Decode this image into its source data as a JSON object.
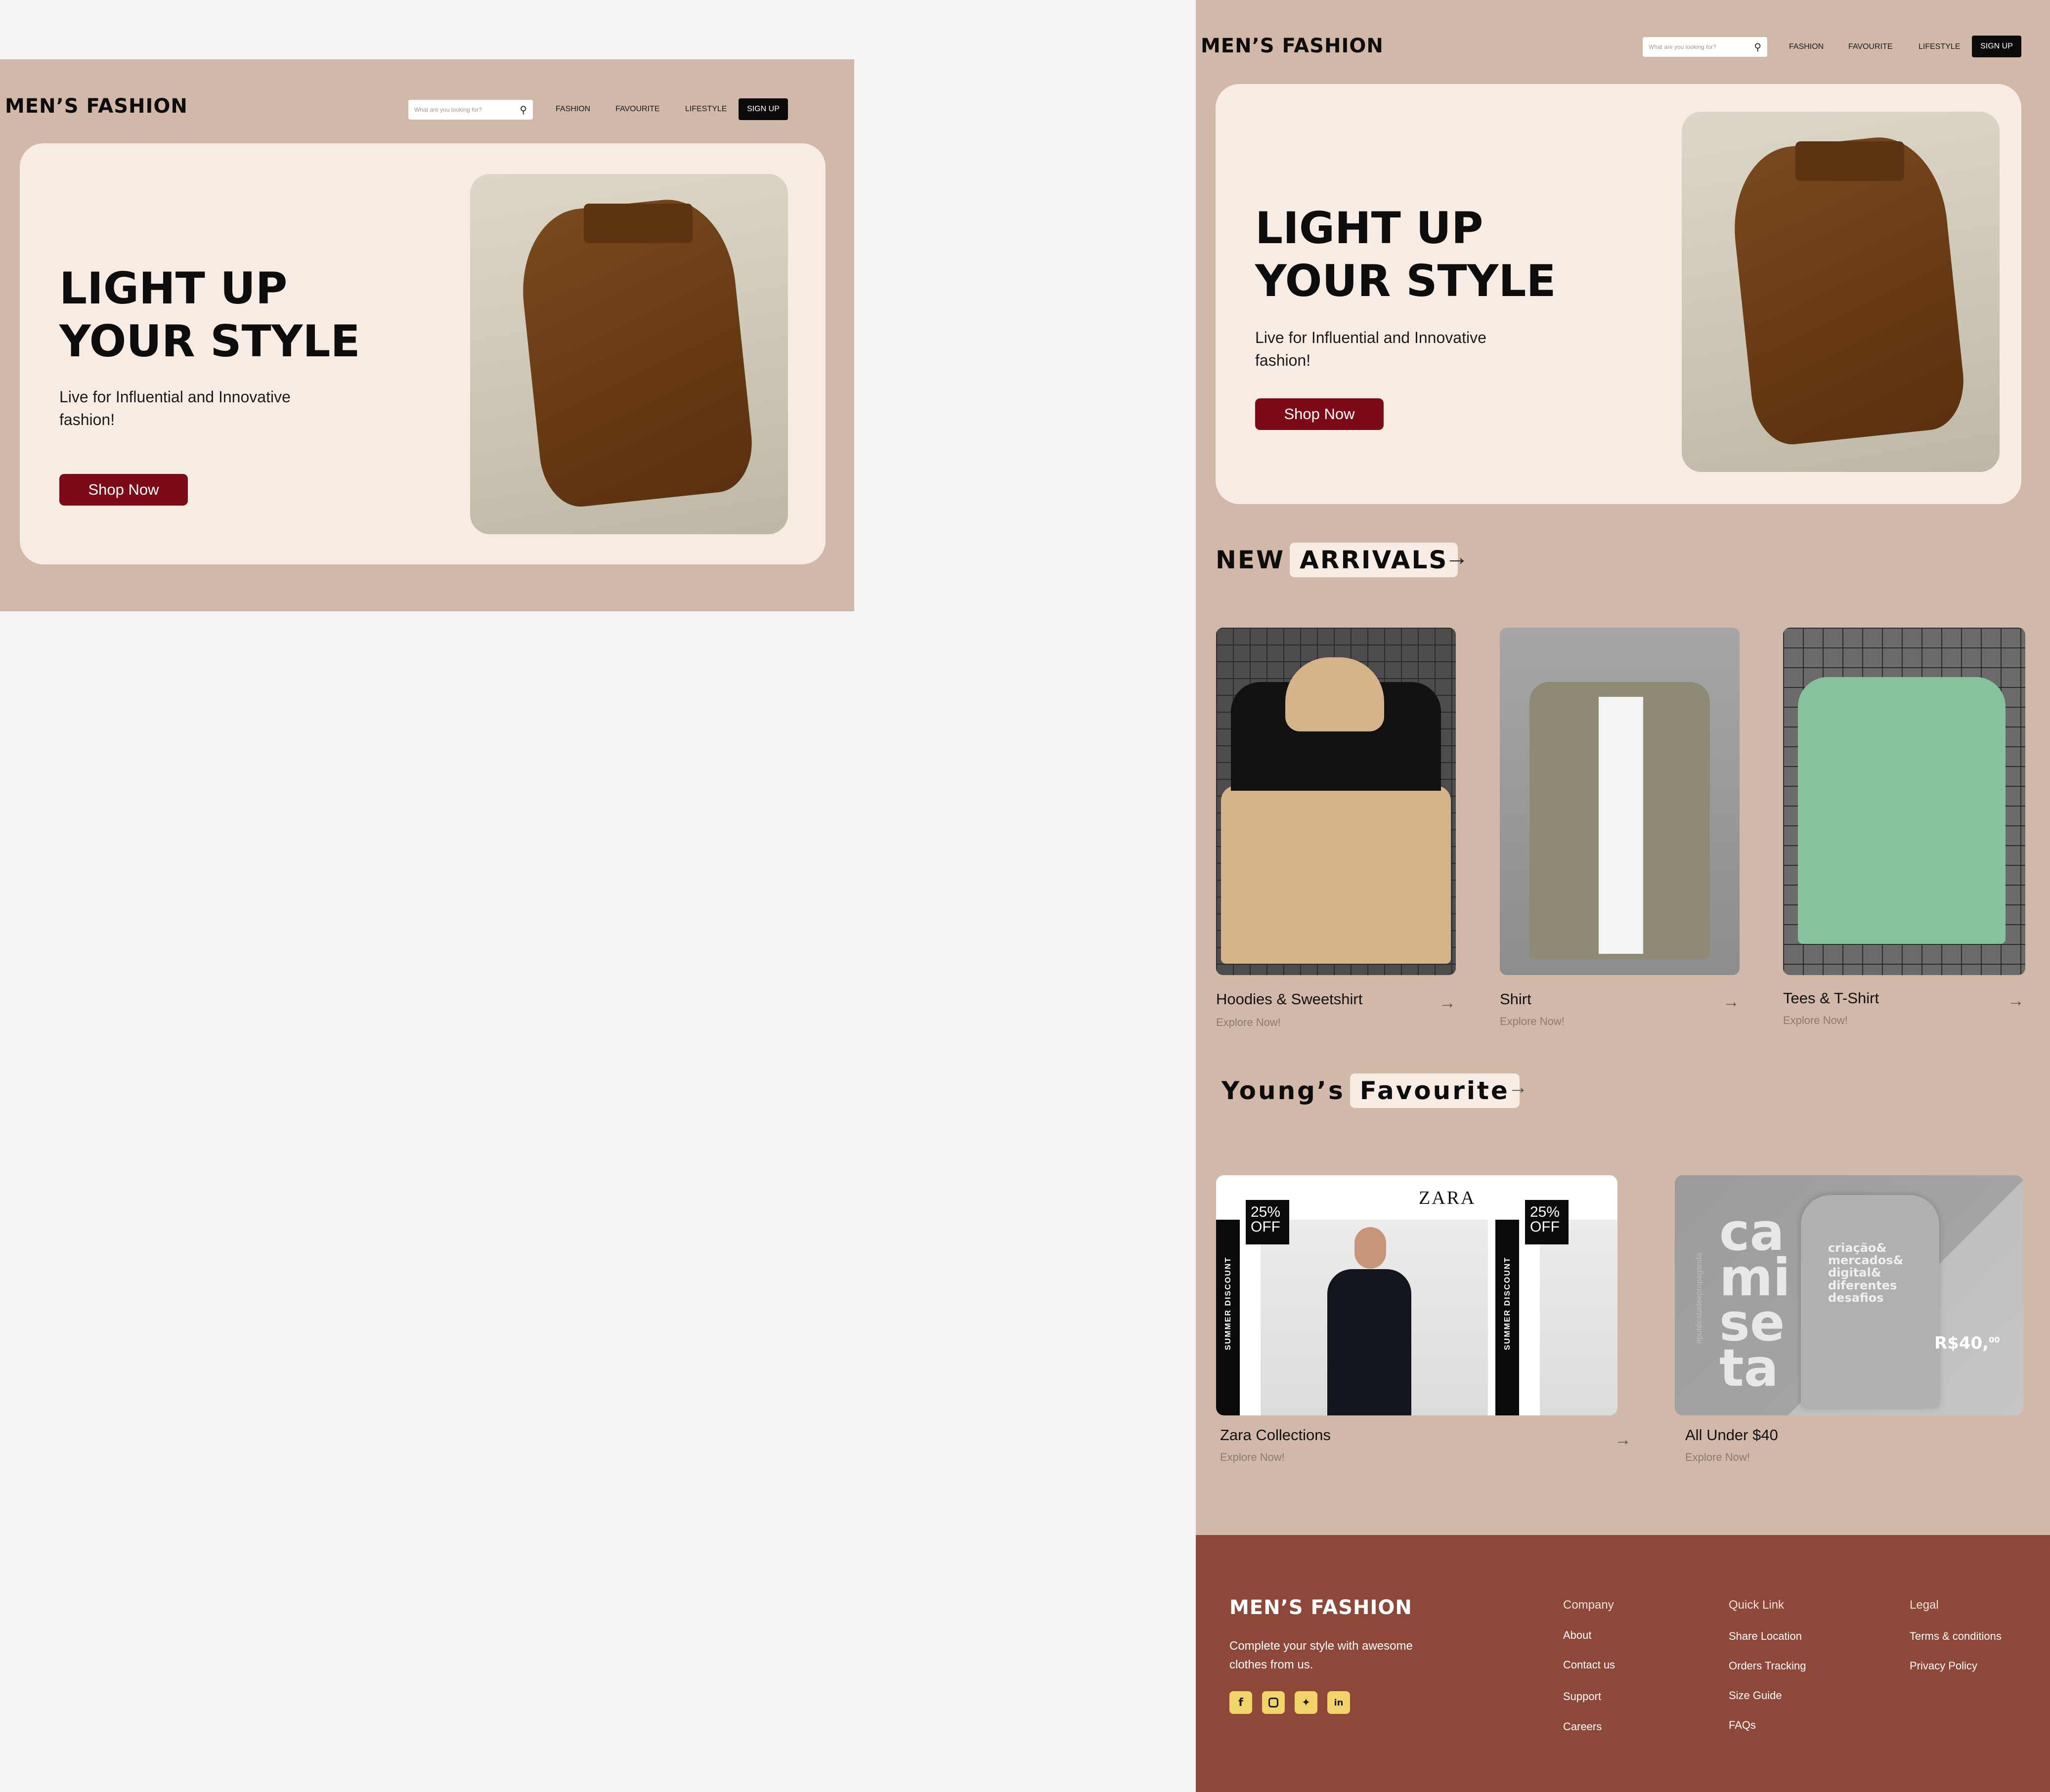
{
  "brand": "MEN’S FASHION",
  "search": {
    "placeholder": "What are you looking for?"
  },
  "nav": {
    "fashion": "FASHION",
    "favourite": "FAVOURITE",
    "lifestyle": "LIFESTYLE",
    "signup": "SIGN UP"
  },
  "hero": {
    "title_line1": "LIGHT UP",
    "title_line2": "YOUR STYLE",
    "subtitle_line1": "Live for Influential and Innovative",
    "subtitle_line2": "fashion!",
    "button": "Shop Now"
  },
  "new_arrivals": {
    "title_plain": "NEW",
    "title_highlight": "ARRIVALS",
    "items": [
      {
        "name": "Hoodies & Sweetshirt",
        "sub": "Explore Now!"
      },
      {
        "name": "Shirt",
        "sub": "Explore Now!"
      },
      {
        "name": "Tees & T-Shirt",
        "sub": "Explore Now!"
      }
    ]
  },
  "favourite": {
    "title_plain": "Young’s",
    "title_highlight": "Favourite",
    "items": [
      {
        "name": "Zara Collections",
        "sub": "Explore Now!"
      },
      {
        "name": "All Under $40",
        "sub": "Explore Now!"
      }
    ],
    "zara_ad": {
      "logo": "ZARA",
      "discount_pct": "25%",
      "discount_off": "OFF",
      "side_text": "SUMMER DISCOUNT"
    },
    "camiseta_ad": {
      "big_text": "camiseta",
      "shirt_text": "criação& mercados& digital& diferentes desafios",
      "price": "R$40,",
      "price_cents": "00",
      "side_text": "#publicidadeepropaganda"
    }
  },
  "footer": {
    "brand": "MEN’S FASHION",
    "tagline_line1": "Complete your style with awesome",
    "tagline_line2": "clothes from us.",
    "social": [
      "facebook-icon",
      "instagram-icon",
      "twitter-icon",
      "linkedin-icon"
    ],
    "company": {
      "head": "Company",
      "links": [
        "About",
        "Contact us",
        "Support",
        "Careers"
      ]
    },
    "quick": {
      "head": "Quick Link",
      "links": [
        "Share Location",
        "Orders Tracking",
        "Size Guide",
        "FAQs"
      ]
    },
    "legal": {
      "head": "Legal",
      "links": [
        "Terms & conditions",
        "Privacy Policy"
      ]
    }
  },
  "colors": {
    "page_bg": "#f4f4f4",
    "panel_bg": "#d1b8a9",
    "card_bg": "#f7ece3",
    "accent_button": "#7c0a17",
    "footer_bg": "#8d483a",
    "social_bg": "#f2d46a"
  }
}
